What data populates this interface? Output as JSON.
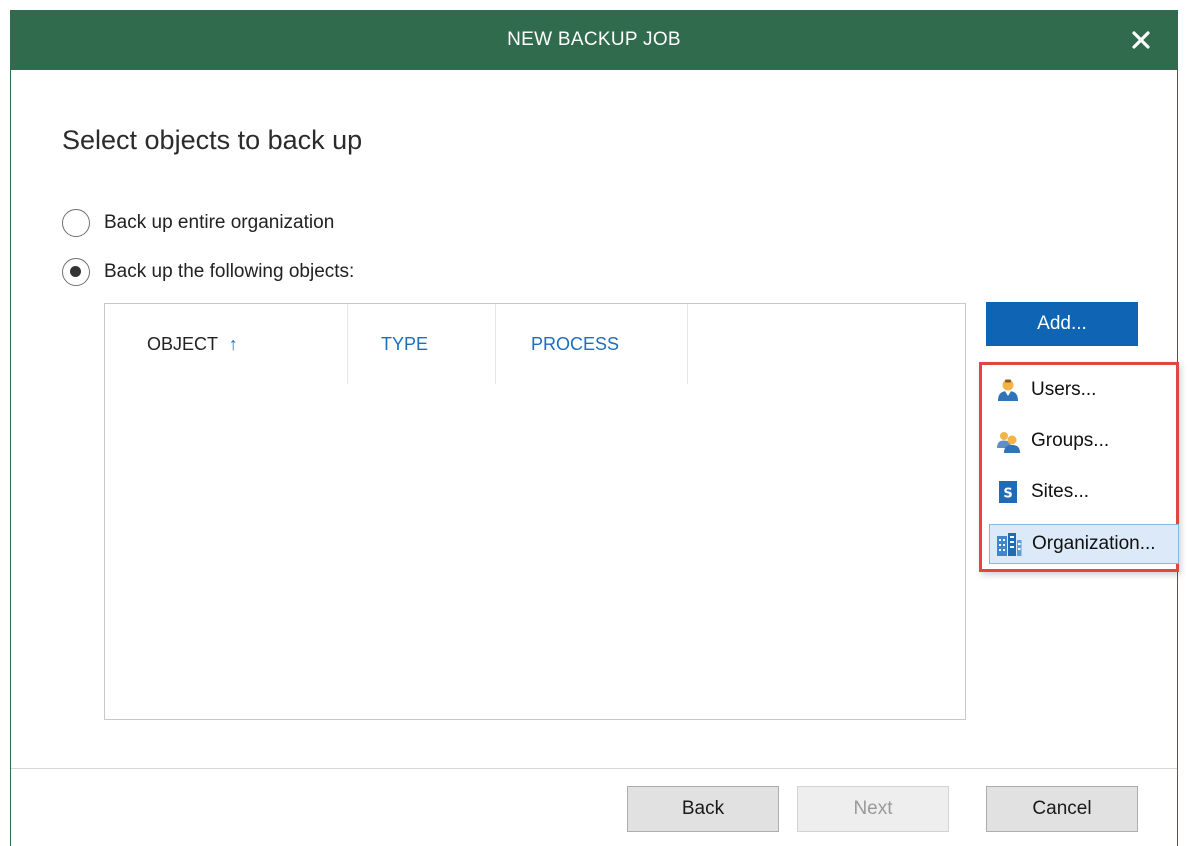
{
  "dialog": {
    "title": "NEW BACKUP JOB",
    "close_icon": "close-icon"
  },
  "page": {
    "heading": "Select objects to back up"
  },
  "scope": {
    "options": [
      {
        "label": "Back up entire organization",
        "checked": false
      },
      {
        "label": "Back up the following objects:",
        "checked": true
      }
    ]
  },
  "grid": {
    "columns": [
      {
        "label": "OBJECT",
        "sort_indicator": "↑",
        "sorted": true
      },
      {
        "label": "TYPE",
        "sorted": false
      },
      {
        "label": "PROCESS",
        "sorted": false
      }
    ],
    "rows": []
  },
  "add_button": {
    "label": "Add..."
  },
  "add_menu": {
    "items": [
      {
        "label": "Users...",
        "icon": "user-icon",
        "selected": false
      },
      {
        "label": "Groups...",
        "icon": "group-icon",
        "selected": false
      },
      {
        "label": "Sites...",
        "icon": "sharepoint-sites-icon",
        "selected": false
      },
      {
        "label": "Organization...",
        "icon": "organization-icon",
        "selected": true
      }
    ],
    "highlight_color": "#e3453f"
  },
  "footer": {
    "back_label": "Back",
    "next_label": "Next",
    "next_enabled": false,
    "cancel_label": "Cancel"
  },
  "colors": {
    "titlebar": "#2f6b4c",
    "accent": "#0f64b4",
    "header_link": "#1a6fbf"
  }
}
